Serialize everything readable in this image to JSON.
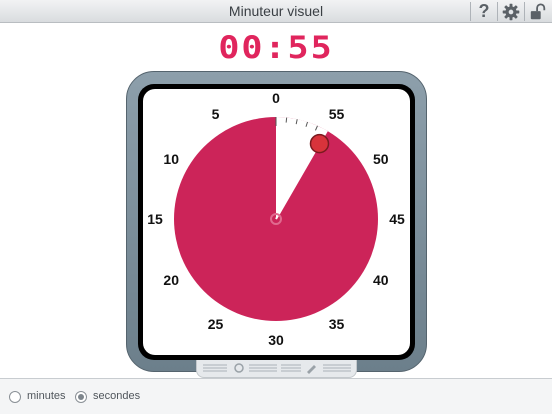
{
  "window": {
    "title": "Minuteur visuel"
  },
  "toolbar": {
    "help_label": "?"
  },
  "timer": {
    "display": "00:55",
    "remaining_seconds": 55,
    "full_scale_seconds": 60,
    "dial_color": "#cc2459",
    "digit_color": "#e0255d",
    "dial_labels": [
      "0",
      "5",
      "10",
      "15",
      "20",
      "25",
      "30",
      "35",
      "40",
      "45",
      "50",
      "55"
    ]
  },
  "footer": {
    "unit_options": [
      {
        "label": "minutes",
        "selected": false
      },
      {
        "label": "secondes",
        "selected": true
      }
    ]
  },
  "icons": [
    "help-icon",
    "gear-icon",
    "lock-icon",
    "knob-icon",
    "pencil-icon"
  ]
}
